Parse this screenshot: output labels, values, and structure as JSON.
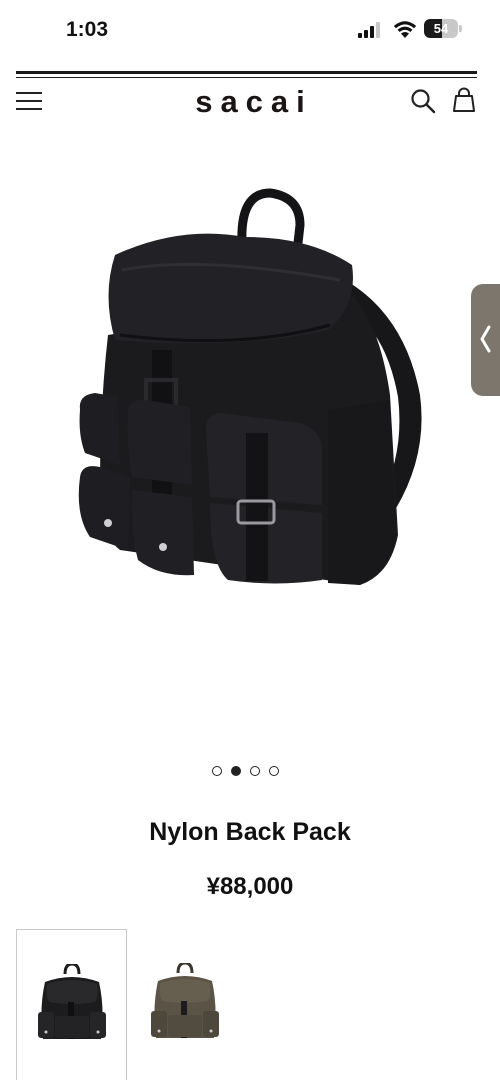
{
  "status_bar": {
    "time": "1:03",
    "battery_level": "54",
    "icons": [
      "signal-icon",
      "wifi-icon",
      "battery-icon"
    ]
  },
  "header": {
    "brand": "sacai",
    "icons": [
      "menu-icon",
      "search-icon",
      "shopping-bag-icon"
    ]
  },
  "product": {
    "title": "Nylon Back Pack",
    "price": "¥88,000",
    "image_count": 4,
    "active_image_index": 1,
    "colors": [
      {
        "name": "black",
        "swatch": "#1c1c1e",
        "selected": true
      },
      {
        "name": "khaki",
        "swatch": "#5a5346",
        "selected": false
      }
    ]
  },
  "colors": {
    "text": "#111111",
    "side_handle": "#7d766c"
  }
}
